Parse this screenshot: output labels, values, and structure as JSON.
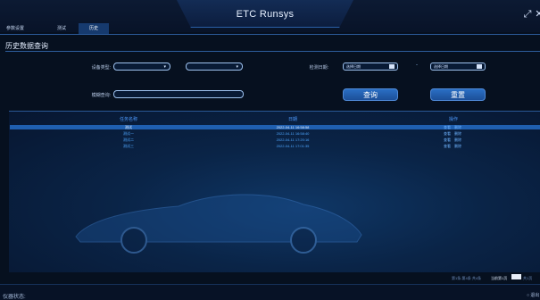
{
  "app": {
    "title": "ETC Runsys"
  },
  "tabs": [
    {
      "label": "参数设置",
      "active": false
    },
    {
      "label": "测试",
      "active": false
    },
    {
      "label": "历史",
      "active": true
    }
  ],
  "panel": {
    "title": "历史数据查询"
  },
  "filters": {
    "device_type_label": "设备类型:",
    "detect_date_label": "检测日期:",
    "date_start_placeholder": "选择日期",
    "date_end_placeholder": "选择日期",
    "date_separator": "-",
    "fuzzy_label": "模糊查询:",
    "query_button": "查询",
    "reset_button": "重置"
  },
  "table": {
    "headers": [
      "任务名称",
      "日期",
      "操作"
    ],
    "rows": [
      {
        "name": "测试",
        "date": "2022-04-11 16:58:58",
        "view": "查看",
        "delete": "删除",
        "selected": true
      },
      {
        "name": "测试一",
        "date": "2022-04-11 16:58:40",
        "view": "查看",
        "delete": "删除",
        "selected": false
      },
      {
        "name": "测试二",
        "date": "2022-04-11 17:20:16",
        "view": "查看",
        "delete": "删除",
        "selected": false
      },
      {
        "name": "测试三",
        "date": "2022-04-11 17:01:35",
        "view": "查看",
        "delete": "删除",
        "selected": false
      }
    ]
  },
  "pager": {
    "summary": "第1条-第4条 共4条",
    "current_prefix": "当前第1页",
    "total_suffix": "共1页"
  },
  "status": {
    "left": "仪器状态:",
    "right": "○ 退出"
  },
  "colors": {
    "accent": "#1f5fb0",
    "header_text": "#4e9bff",
    "link": "#4ea7ff"
  },
  "icons": {
    "restore": "restore-window-icon",
    "close": "close-icon",
    "dropdown": "chevron-down-icon",
    "calendar": "calendar-icon"
  }
}
